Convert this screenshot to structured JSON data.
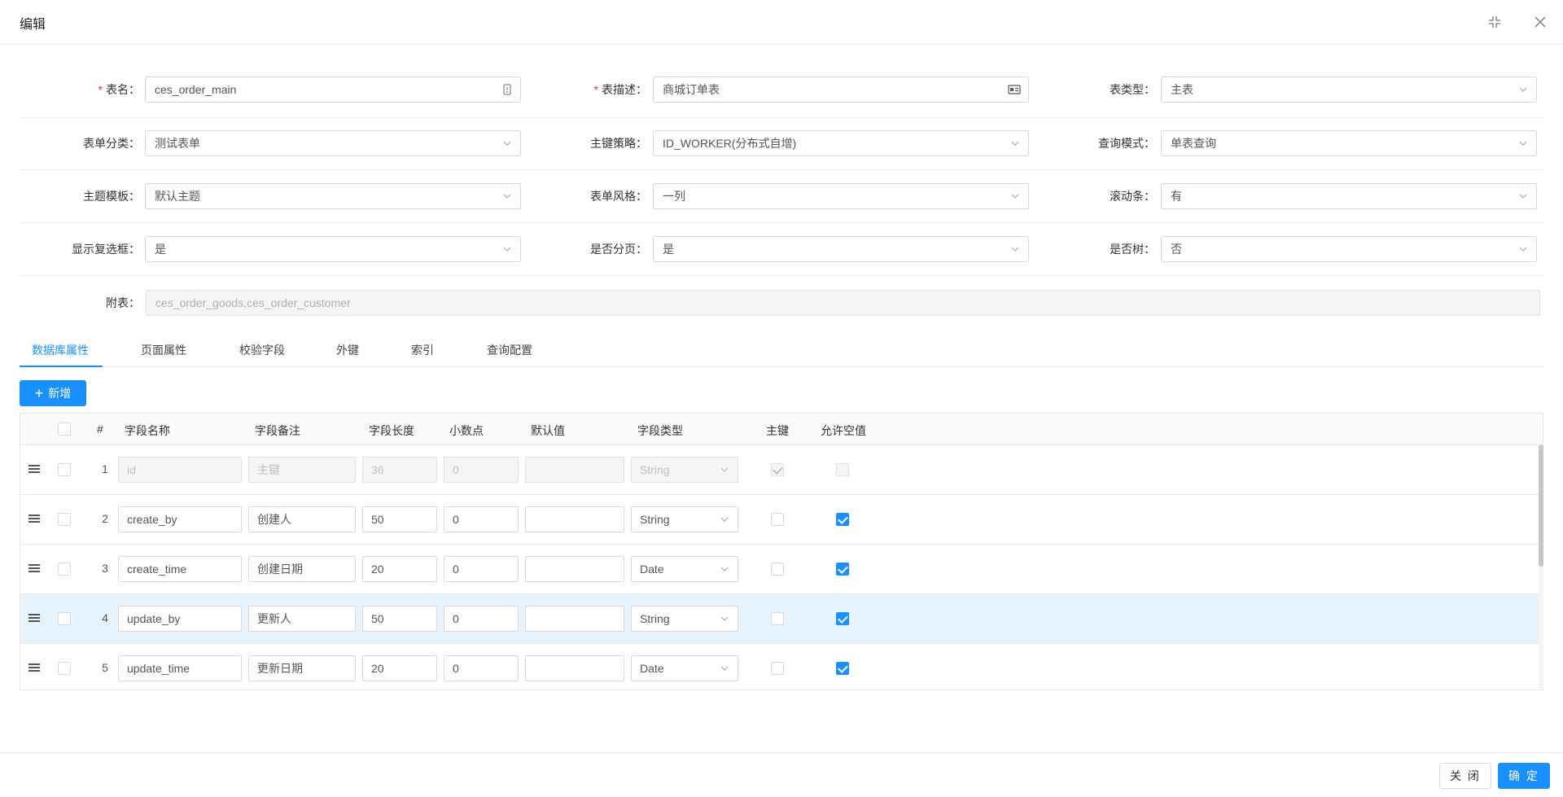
{
  "modal": {
    "title": "编辑"
  },
  "form": {
    "table_name": {
      "label": "表名",
      "value": "ces_order_main"
    },
    "table_desc": {
      "label": "表描述",
      "value": "商城订单表"
    },
    "table_type": {
      "label": "表类型",
      "value": "主表"
    },
    "form_category": {
      "label": "表单分类",
      "value": "测试表单"
    },
    "pk_strategy": {
      "label": "主键策略",
      "value": "ID_WORKER(分布式自增)"
    },
    "query_mode": {
      "label": "查询模式",
      "value": "单表查询"
    },
    "theme_template": {
      "label": "主题模板",
      "value": "默认主题"
    },
    "form_style": {
      "label": "表单风格",
      "value": "一列"
    },
    "scrollbar": {
      "label": "滚动条",
      "value": "有"
    },
    "show_checkbox": {
      "label": "显示复选框",
      "value": "是"
    },
    "pagination": {
      "label": "是否分页",
      "value": "是"
    },
    "is_tree": {
      "label": "是否树",
      "value": "否"
    },
    "sub_tables": {
      "label": "附表",
      "value": "ces_order_goods,ces_order_customer"
    }
  },
  "tabs": [
    "数据库属性",
    "页面属性",
    "校验字段",
    "外键",
    "索引",
    "查询配置"
  ],
  "add_button": {
    "label": "新增"
  },
  "table": {
    "headers": {
      "index": "#",
      "field_name": "字段名称",
      "field_comment": "字段备注",
      "field_length": "字段长度",
      "decimal": "小数点",
      "default": "默认值",
      "field_type": "字段类型",
      "pk": "主键",
      "nullable": "允许空值"
    },
    "rows": [
      {
        "num": "1",
        "name": "id",
        "comment": "主键",
        "length": "36",
        "decimal": "0",
        "default": "",
        "type": "String"
      },
      {
        "num": "2",
        "name": "create_by",
        "comment": "创建人",
        "length": "50",
        "decimal": "0",
        "default": "",
        "type": "String"
      },
      {
        "num": "3",
        "name": "create_time",
        "comment": "创建日期",
        "length": "20",
        "decimal": "0",
        "default": "",
        "type": "Date"
      },
      {
        "num": "4",
        "name": "update_by",
        "comment": "更新人",
        "length": "50",
        "decimal": "0",
        "default": "",
        "type": "String"
      },
      {
        "num": "5",
        "name": "update_time",
        "comment": "更新日期",
        "length": "20",
        "decimal": "0",
        "default": "",
        "type": "Date"
      }
    ]
  },
  "footer": {
    "close_label": "关 闭",
    "ok_label": "确 定"
  },
  "colors": {
    "primary": "#1890ff",
    "required": "#f5222d",
    "row_highlight": "#e8f4fd"
  }
}
